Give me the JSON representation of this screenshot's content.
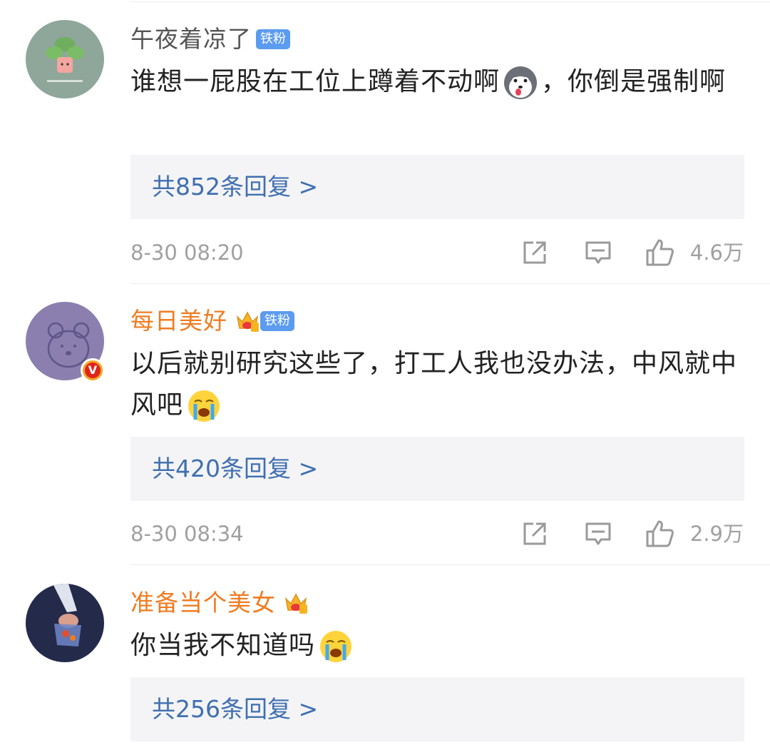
{
  "colors": {
    "username_plain": "#555555",
    "username_vip": "#f07c22",
    "reply_link": "#3f6fb0",
    "meta": "#a0a0a0",
    "fan_badge": "#5b9bf0"
  },
  "comments": [
    {
      "username": "午夜着凉了",
      "username_style": "plain",
      "crown": false,
      "fan_badge": "铁粉",
      "verified": false,
      "avatar_icon": "plant-avatar-icon",
      "text_part1": "谁想一屁股在工位上蹲着不动啊",
      "emoji": "husky-dog-emoji",
      "text_part2": "，你倒是强制啊",
      "reply_link": "共852条回复 >",
      "time": "8-30 08:20",
      "likes": "4.6万"
    },
    {
      "username": "每日美好",
      "username_style": "vip",
      "crown": true,
      "fan_badge": "铁粉",
      "verified": true,
      "avatar_icon": "bear-avatar-icon",
      "text_part1": "以后就别研究这些了，打工人我也没办法，中风就中风吧",
      "emoji": "crying-face-emoji",
      "text_part2": "",
      "reply_link": "共420条回复 >",
      "time": "8-30 08:34",
      "likes": "2.9万"
    },
    {
      "username": "准备当个美女",
      "username_style": "vip",
      "crown": true,
      "fan_badge": "",
      "verified": false,
      "avatar_icon": "hands-avatar-icon",
      "text_part1": "你当我不知道吗",
      "emoji": "crying-face-emoji",
      "text_part2": "",
      "reply_link": "共256条回复 >",
      "time": "",
      "likes": ""
    }
  ],
  "badges": {
    "verified_letter": "V",
    "crown_level": "6"
  }
}
